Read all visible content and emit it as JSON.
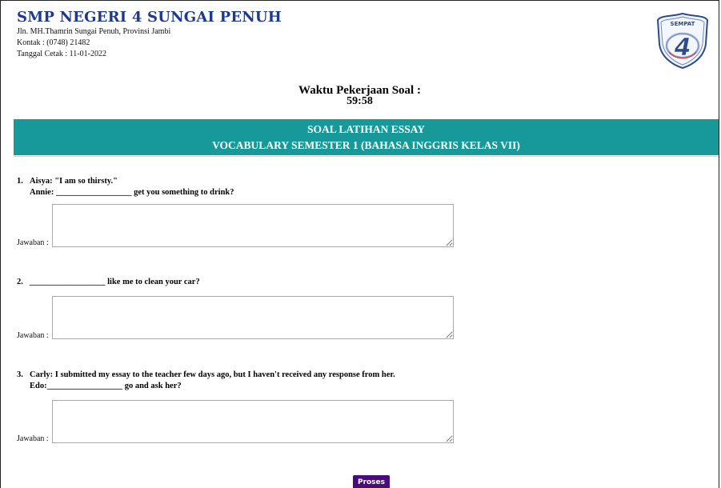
{
  "header": {
    "school_name": "SMP NEGERI 4 SUNGAI PENUH",
    "address": "Jln. MH.Thamrin Sungai Penuh, Provinsi Jambi",
    "contact": "Kontak : (0748) 21482",
    "print_date": "Tanggal Cetak : 11-01-2022",
    "logo_icon": "school-crest-icon",
    "logo_text": "SEMPAT"
  },
  "timer": {
    "label": "Waktu Pekerjaan Soal :",
    "value": "59:58"
  },
  "banner": {
    "title": "SOAL LATIHAN ESSAY",
    "subtitle": "VOCABULARY SEMESTER 1 (BAHASA INGGRIS KELAS VII)"
  },
  "colors": {
    "school_name": "#1e3a8a",
    "banner_bg": "#17999a",
    "button_bg": "#4b0a7e"
  },
  "questions": [
    {
      "number": "1.",
      "line1": "Aisya: \"I am so thirsty.\"",
      "line2": "Annie: __________________ get you something to drink?",
      "answer_label": "Jawaban :",
      "answer_value": ""
    },
    {
      "number": "2.",
      "line1": "__________________ like me to clean your car?",
      "line2": "",
      "answer_label": "Jawaban :",
      "answer_value": ""
    },
    {
      "number": "3.",
      "line1": "Carly: I submitted my essay to the teacher few days ago, but I haven't received any response from her.",
      "line2": "Edo:__________________ go and ask her?",
      "answer_label": "Jawaban :",
      "answer_value": ""
    }
  ],
  "submit": {
    "label": "Proses"
  }
}
